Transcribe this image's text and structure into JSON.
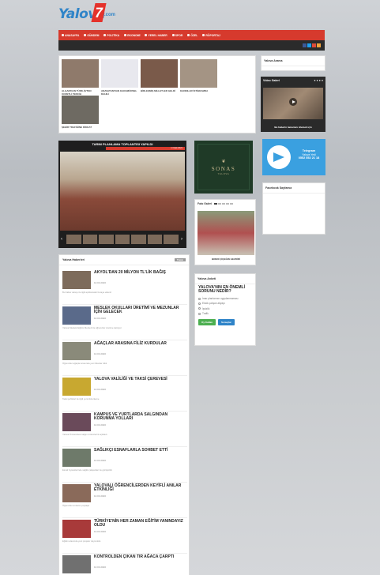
{
  "header": {
    "logo_text": "Yalova",
    "logo_num": "7",
    "logo_suffix": ".com"
  },
  "nav": [
    "ANASAYFA",
    "GÜNDEM",
    "POLİTİKA",
    "EKONOMİ",
    "YEREL HABER",
    "SPOR",
    "ÖZEL",
    "RÖPORTAJ"
  ],
  "top_strip": [
    {
      "caption": "ALGAN'DAN TÜRK-İŞ'TEN ÜCRETLİ TERCİH"
    },
    {
      "caption": "ANAVATAN'DAN KARAMÜRSEL DAHİLİ"
    },
    {
      "caption": "BİRLEŞMİŞ MİLLETLER GELDİ"
    },
    {
      "caption": "KADINLAR İSTİHDAMDA"
    },
    {
      "caption": "ŞEHİR TRAFİĞİNE DİKKAT"
    }
  ],
  "sidebar": {
    "search_title": "Yalova Arama",
    "video_title": "Video Galeri",
    "video_caption": "Bu haberin tamamını izlemek için",
    "facebook_title": "Facebook Sayfamız"
  },
  "slider": {
    "title": "TARIM PLANLAMA TOPLANTISI YAPILDI",
    "date": "1 Ocak 2021"
  },
  "ad": {
    "name": "SONAS",
    "sub": "YALOVA"
  },
  "telegram": {
    "line1": "Telegram",
    "line2": "Yalova Yedi",
    "line3": "0552 552 21 18"
  },
  "photo_gallery": {
    "title": "Foto Galeri",
    "caption": "BREDİ ÇİÇEĞİN GEZDİRİ"
  },
  "poll": {
    "title": "Yalova Anketi",
    "question": "YALOVA'NIN EN ÖNEMLİ SORUNU NEDİR?",
    "options": [
      "İmar planlarının uygulanmaması",
      "Eksik çalışan altyapı",
      "İşsizlik",
      "Trafik"
    ],
    "vote_label": "Oy Kullan",
    "results_label": "Sonuçlar"
  },
  "news": {
    "title": "Yalova Haberleri",
    "more": "Tümü",
    "items": [
      {
        "title": "AKYOL'DAN 20 MİLYON TL'LİK BAĞIŞ",
        "date": "10.03.2020",
        "text": "Bu haber detayı ile ilgili açıklamalar buraya eklenir"
      },
      {
        "title": "MESLEK OKULLARI ÜRETİMİ VE MEZUNLAR İÇİN GELECEK",
        "date": "10.03.2020",
        "text": "Yalova Mesleki Eğitim Merkezi ile öğrenciler üretime katılıyor"
      },
      {
        "title": "AĞAÇLAR ARASINA FİLİZ KURDULAR",
        "date": "10.03.2020",
        "text": "Öğrenciler ağaçlar arasında yeni fidanlar dikti"
      },
      {
        "title": "YALOVA VALİLİĞİ VE TAKSİ ÇEREVESİ",
        "date": "10.03.2020",
        "text": "Taksi şoförleri ile ilgili yeni düzenleme"
      },
      {
        "title": "KAMPUS VE YURTLARDA SALGINDAN KORUNMA YOLLARI",
        "date": "10.03.2020",
        "text": "Yalova Üniversitesi salgın önlemlerini açıkladı"
      },
      {
        "title": "SAĞLIKÇI ESNAFLARLA SOHBET ETTİ",
        "date": "10.03.2020",
        "text": "Esnaf ziyaretlerinde sağlık çalışanları ile görüşüldü"
      },
      {
        "title": "YALOVALI ÖĞRENCİLERDEN KEYİFLİ ANILAR ETKİNLİĞİ",
        "date": "10.03.2020",
        "text": "Öğrenciler anılarını paylaştı"
      },
      {
        "title": "TÜRKİYE'NİN HER ZAMAN EĞİTİM YANINDAYIZ OLDU",
        "date": "10.03.2020",
        "text": "Eğitim alanında yeni projeler duyuruldu"
      },
      {
        "title": "KONTROLDEN ÇIKAN TIR AĞACA ÇARPTI",
        "date": "10.03.2020",
        "text": ""
      }
    ]
  }
}
